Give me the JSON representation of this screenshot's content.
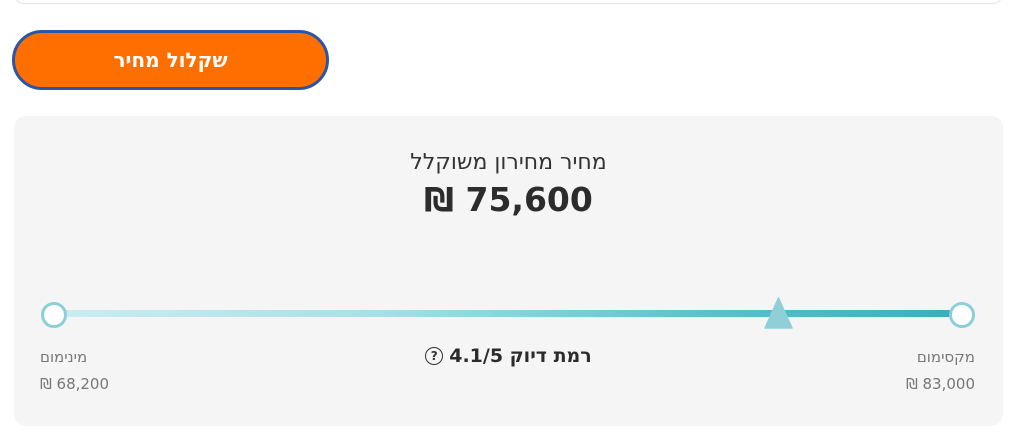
{
  "action_button": {
    "label": "שקלול מחיר"
  },
  "result": {
    "title": "מחיר מחירון משוקלל",
    "price": "₪ 75,600"
  },
  "range": {
    "min_label": "מינימום",
    "min_value": "₪ 68,200",
    "max_label": "מקסימום",
    "max_value": "₪ 83,000",
    "accuracy_text": "רמת דיוק 4.1/5",
    "help_symbol": "?"
  },
  "colors": {
    "button_fill": "#ff6f00",
    "button_border": "#2a55a8",
    "track_end": "#37afbd",
    "marker": "#8ecfd8"
  },
  "icons": [
    "help-icon",
    "position-marker-icon"
  ]
}
